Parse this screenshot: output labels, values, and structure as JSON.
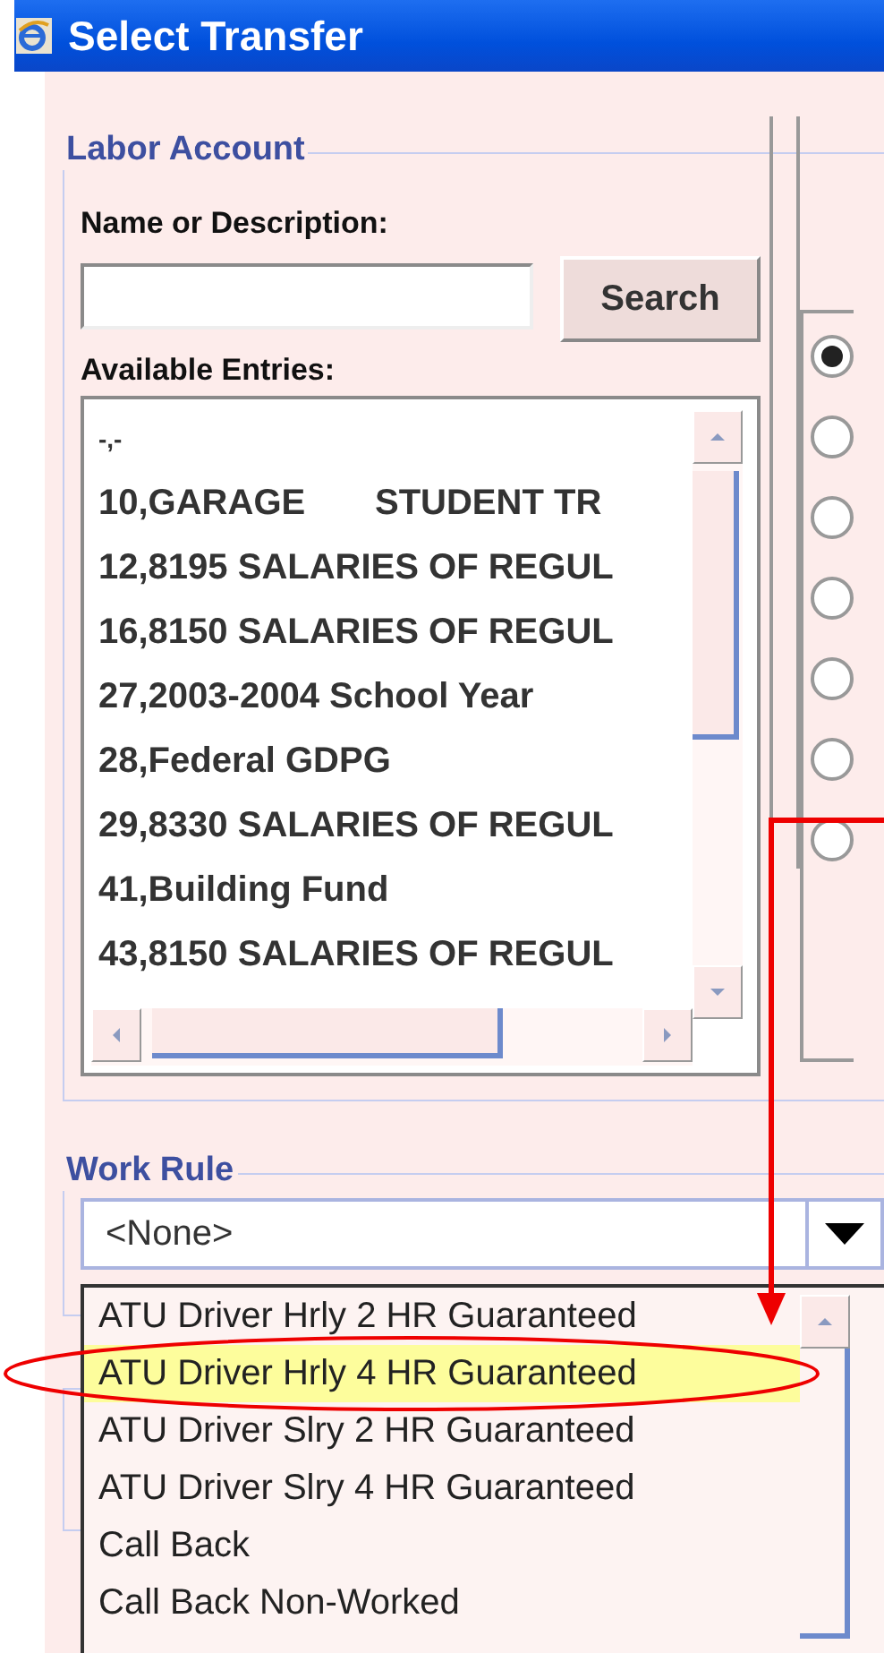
{
  "window": {
    "title": "Select Transfer"
  },
  "labor_account": {
    "legend": "Labor Account",
    "name_label": "Name or Description:",
    "search_button": "Search",
    "entries_label": "Available Entries:",
    "entries": [
      "-,-",
      "10,GARAGE       STUDENT TR",
      "12,8195 SALARIES OF REGUL",
      "16,8150 SALARIES OF REGUL",
      "27,2003-2004 School Year",
      "28,Federal GDPG",
      "29,8330 SALARIES OF REGUL",
      "41,Building Fund",
      "43,8150 SALARIES OF REGUL"
    ]
  },
  "options_panel": {
    "radios": [
      {
        "selected": true
      },
      {
        "selected": false
      },
      {
        "selected": false
      },
      {
        "selected": false
      },
      {
        "selected": false
      },
      {
        "selected": false
      },
      {
        "selected": false
      }
    ]
  },
  "work_rule": {
    "legend": "Work Rule",
    "value": "<None>",
    "dropdown_items": [
      {
        "label": "ATU Driver Hrly 2 HR Guaranteed",
        "selected": false
      },
      {
        "label": "ATU Driver Hrly 4 HR Guaranteed",
        "selected": true
      },
      {
        "label": "ATU Driver Slry 2 HR Guaranteed",
        "selected": false
      },
      {
        "label": "ATU Driver Slry 4 HR Guaranteed",
        "selected": false
      },
      {
        "label": "Call Back",
        "selected": false
      },
      {
        "label": "Call Back Non-Worked",
        "selected": false
      }
    ]
  },
  "annotations": {
    "arrow": true,
    "highlight_ellipse": true
  }
}
